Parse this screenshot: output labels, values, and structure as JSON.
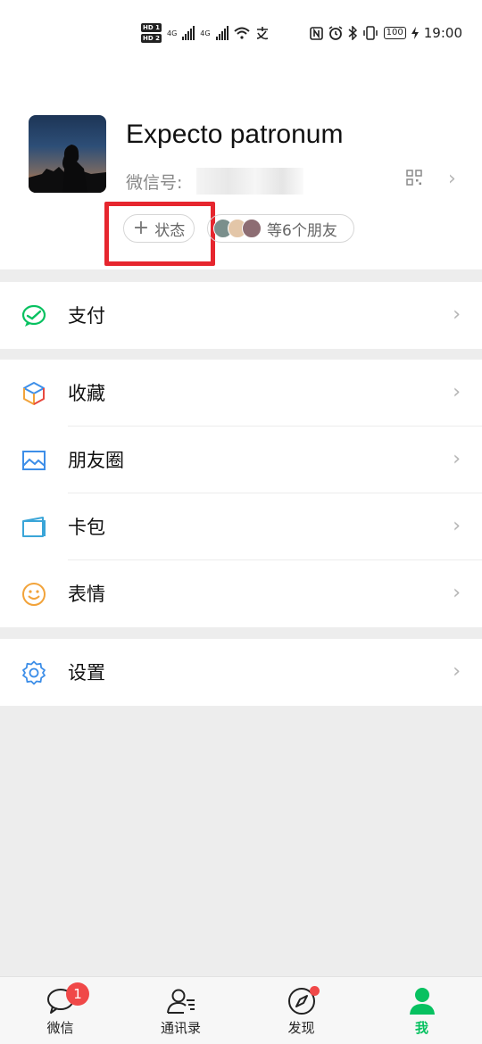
{
  "status_bar": {
    "hd1": "HD 1",
    "hd2": "HD 2",
    "net1": "4G",
    "net2": "4G",
    "time": "19:00",
    "battery": "100",
    "icons": [
      "nfc-icon",
      "alarm-icon",
      "bluetooth-icon",
      "vibrate-icon",
      "charging-icon",
      "wifi-icon",
      "pay-icon"
    ]
  },
  "profile": {
    "nickname": "Expecto patronum",
    "wechat_id_label": "微信号:",
    "status_button": "状态",
    "status_plus": "+",
    "friends_text": "等6个朋友"
  },
  "menu": {
    "pay": "支付",
    "favorites": "收藏",
    "moments": "朋友圈",
    "cards": "卡包",
    "stickers": "表情",
    "settings": "设置"
  },
  "tabs": {
    "chats": "微信",
    "contacts": "通讯录",
    "discover": "发现",
    "me": "我",
    "chats_badge": "1"
  },
  "colors": {
    "accent": "#07c160",
    "highlight_box": "#e6262e",
    "badge": "#f04848"
  }
}
